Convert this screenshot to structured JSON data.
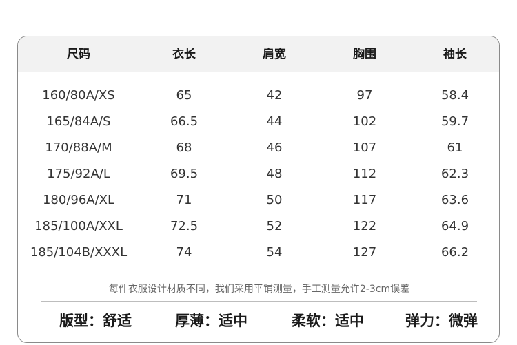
{
  "table": {
    "headers": [
      "尺码",
      "衣长",
      "肩宽",
      "胸围",
      "袖长"
    ],
    "rows": [
      [
        "160/80A/XS",
        "65",
        "42",
        "97",
        "58.4"
      ],
      [
        "165/84A/S",
        "66.5",
        "44",
        "102",
        "59.7"
      ],
      [
        "170/88A/M",
        "68",
        "46",
        "107",
        "61"
      ],
      [
        "175/92A/L",
        "69.5",
        "48",
        "112",
        "62.3"
      ],
      [
        "180/96A/XL",
        "71",
        "50",
        "117",
        "63.6"
      ],
      [
        "185/100A/XXL",
        "72.5",
        "52",
        "122",
        "64.9"
      ],
      [
        "185/104B/XXXL",
        "74",
        "54",
        "127",
        "66.2"
      ]
    ]
  },
  "note": "每件衣服设计材质不同，我们采用平铺测量，手工测量允许2-3cm误差",
  "attributes": [
    "版型：舒适",
    "厚薄：适中",
    "柔软：适中",
    "弹力：微弹"
  ]
}
